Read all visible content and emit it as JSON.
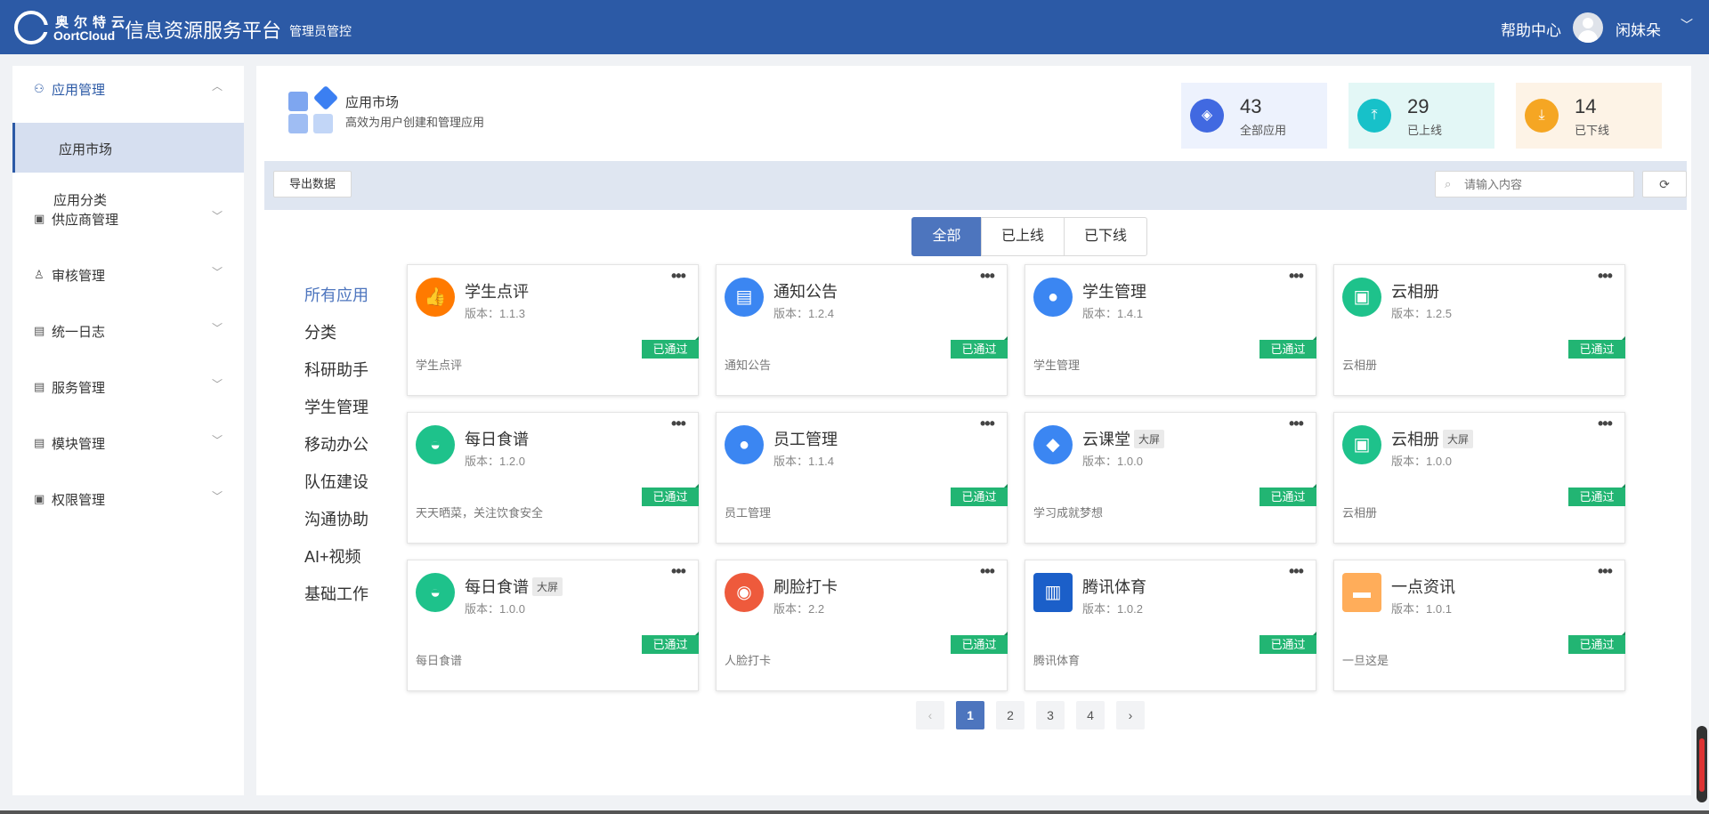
{
  "header": {
    "brand_cn": "奥尔特云",
    "brand_en": "OortCloud",
    "app_title": "信息资源服务平台",
    "app_subtitle": "管理员管控",
    "help": "帮助中心",
    "user_name": "闲妹朵",
    "colors": {
      "bar": "#2c5aa6"
    }
  },
  "sidebar": {
    "groups": [
      {
        "label": "应用管理",
        "icon": "user-icon",
        "open": true,
        "children": [
          "应用市场",
          "应用分类"
        ],
        "active_child": "应用市场"
      },
      {
        "label": "供应商管理",
        "icon": "monitor-icon"
      },
      {
        "label": "审核管理",
        "icon": "stamp-icon"
      },
      {
        "label": "统一日志",
        "icon": "clipboard-icon"
      },
      {
        "label": "服务管理",
        "icon": "clipboard-icon"
      },
      {
        "label": "模块管理",
        "icon": "clipboard-icon"
      },
      {
        "label": "权限管理",
        "icon": "monitor-icon"
      }
    ]
  },
  "page": {
    "title": "应用市场",
    "subtitle": "高效为用户创建和管理应用"
  },
  "stats": [
    {
      "value": "43",
      "label": "全部应用",
      "icon": "layers-icon",
      "color": "#4169e1",
      "bg": "#edf2fd"
    },
    {
      "value": "29",
      "label": "已上线",
      "icon": "upload-icon",
      "color": "#17c1c9",
      "bg": "#e3f7f6"
    },
    {
      "value": "14",
      "label": "已下线",
      "icon": "download-icon",
      "color": "#f5a623",
      "bg": "#fdf3e6"
    }
  ],
  "toolbar": {
    "export_label": "导出数据",
    "search_placeholder": "请输入内容"
  },
  "tabs": [
    "全部",
    "已上线",
    "已下线"
  ],
  "active_tab": "全部",
  "categories": [
    "所有应用",
    "分类",
    "科研助手",
    "学生管理",
    "移动办公",
    "队伍建设",
    "沟通协助",
    "AI+视频",
    "基础工作"
  ],
  "active_category": "所有应用",
  "version_prefix": "版本：",
  "status_label": "已通过",
  "apps": [
    {
      "name": "学生点评",
      "version": "1.1.3",
      "desc": "学生点评",
      "badge": "",
      "icon": "thumbs-up-icon",
      "color": "#ff7a00",
      "glyph": "👍"
    },
    {
      "name": "通知公告",
      "version": "1.2.4",
      "desc": "通知公告",
      "badge": "",
      "icon": "document-icon",
      "color": "#3b86f2",
      "glyph": "▤"
    },
    {
      "name": "学生管理",
      "version": "1.4.1",
      "desc": "学生管理",
      "badge": "",
      "icon": "person-icon",
      "color": "#3b86f2",
      "glyph": "●"
    },
    {
      "name": "云相册",
      "version": "1.2.5",
      "desc": "云相册",
      "badge": "",
      "icon": "image-icon",
      "color": "#1ec28b",
      "glyph": "▣"
    },
    {
      "name": "每日食谱",
      "version": "1.2.0",
      "desc": "天天晒菜，关注饮食安全",
      "badge": "",
      "icon": "dish-icon",
      "color": "#1ec28b",
      "glyph": "◒"
    },
    {
      "name": "员工管理",
      "version": "1.1.4",
      "desc": "员工管理",
      "badge": "",
      "icon": "person-icon",
      "color": "#3b86f2",
      "glyph": "●"
    },
    {
      "name": "云课堂",
      "version": "1.0.0",
      "desc": "学习成就梦想",
      "badge": "大屏",
      "icon": "graduation-cap-icon",
      "color": "#3b86f2",
      "glyph": "◆"
    },
    {
      "name": "云相册",
      "version": "1.0.0",
      "desc": "云相册",
      "badge": "大屏",
      "icon": "image-icon",
      "color": "#1ec28b",
      "glyph": "▣"
    },
    {
      "name": "每日食谱",
      "version": "1.0.0",
      "desc": "每日食谱",
      "badge": "大屏",
      "icon": "dish-icon",
      "color": "#1ec28b",
      "glyph": "◒"
    },
    {
      "name": "刷脸打卡",
      "version": "2.2",
      "desc": "人脸打卡",
      "badge": "",
      "icon": "face-scan-icon",
      "color": "#ee5a3c",
      "glyph": "◉"
    },
    {
      "name": "腾讯体育",
      "version": "1.0.2",
      "desc": "腾讯体育",
      "badge": "",
      "icon": "sports-logo-icon",
      "color": "#1b5fc9",
      "glyph": "▥",
      "square": true
    },
    {
      "name": "一点资讯",
      "version": "1.0.1",
      "desc": "一旦这是",
      "badge": "",
      "icon": "news-box-icon",
      "color": "#ffad5a",
      "glyph": "▬",
      "square": true
    }
  ],
  "pagination": {
    "pages": [
      "1",
      "2",
      "3",
      "4"
    ],
    "current": "1"
  }
}
